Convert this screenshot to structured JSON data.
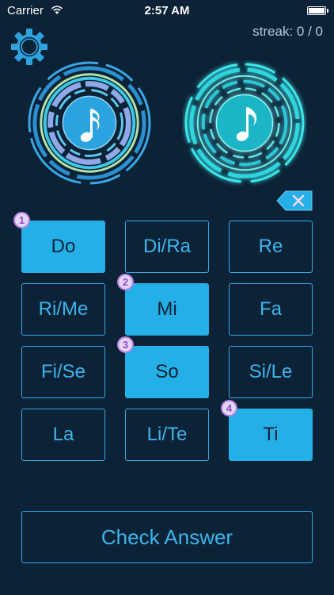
{
  "status_bar": {
    "carrier": "Carrier",
    "time": "2:57 AM"
  },
  "header": {
    "streak_label": "streak: 0 / 0",
    "settings_icon": "gear-icon"
  },
  "discs": {
    "left_icon": "note-icon",
    "right_icon": "eighth-note-icon",
    "backspace_icon": "backspace-icon"
  },
  "buttons": [
    {
      "label": "Do",
      "selected": true,
      "order": "1"
    },
    {
      "label": "Di/Ra",
      "selected": false
    },
    {
      "label": "Re",
      "selected": false
    },
    {
      "label": "Ri/Me",
      "selected": false
    },
    {
      "label": "Mi",
      "selected": true,
      "order": "2"
    },
    {
      "label": "Fa",
      "selected": false
    },
    {
      "label": "Fi/Se",
      "selected": false
    },
    {
      "label": "So",
      "selected": true,
      "order": "3"
    },
    {
      "label": "Si/Le",
      "selected": false
    },
    {
      "label": "La",
      "selected": false
    },
    {
      "label": "Li/Te",
      "selected": false
    },
    {
      "label": "Ti",
      "selected": true,
      "order": "4"
    }
  ],
  "check_answer": {
    "label": "Check Answer"
  },
  "colors": {
    "background": "#0c2236",
    "accent": "#25afe7",
    "badge_purple": "#b681e2",
    "glow_cyan": "#3ee6e8"
  }
}
